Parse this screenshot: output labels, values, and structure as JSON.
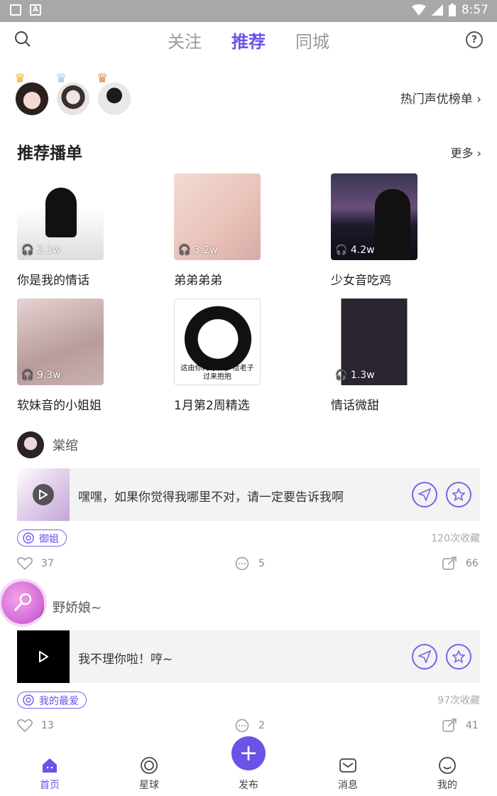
{
  "status_bar": {
    "time": "8:57"
  },
  "top_tabs": [
    {
      "label": "关注",
      "active": false
    },
    {
      "label": "推荐",
      "active": true
    },
    {
      "label": "同城",
      "active": false
    }
  ],
  "hot_voice": {
    "link_label": "热门声优榜单"
  },
  "playlist_section": {
    "title": "推荐播单",
    "more_label": "更多",
    "items": [
      {
        "title": "你是我的情话",
        "count": "2.1w"
      },
      {
        "title": "弟弟弟弟",
        "count": "3.2w"
      },
      {
        "title": "少女音吃鸡",
        "count": "4.2w"
      },
      {
        "title": "软妹音的小姐姐",
        "count": "9.3w"
      },
      {
        "title": "1月第2周精选",
        "count": "",
        "thumb_text": "这由你妈可爱了 给老子过来抱抱"
      },
      {
        "title": "情话微甜",
        "count": "1.3w"
      }
    ]
  },
  "posts": [
    {
      "username": "棠绾",
      "text": "嘿嘿，如果你觉得我哪里不对，请一定要告诉我啊",
      "tag": "御姐",
      "favorites": "120次收藏",
      "likes": "37",
      "comments": "5",
      "shares": "66"
    },
    {
      "username": "野娇娘~",
      "text": "我不理你啦！哼~",
      "tag": "我的最爱",
      "favorites": "97次收藏",
      "likes": "13",
      "comments": "2",
      "shares": "41"
    }
  ],
  "bottom_nav": [
    {
      "label": "首页",
      "active": true
    },
    {
      "label": "星球",
      "active": false
    },
    {
      "label": "发布",
      "active": false
    },
    {
      "label": "消息",
      "active": false
    },
    {
      "label": "我的",
      "active": false
    }
  ],
  "colors": {
    "accent": "#6c52e6",
    "statusbar": "#a8a8a8"
  }
}
